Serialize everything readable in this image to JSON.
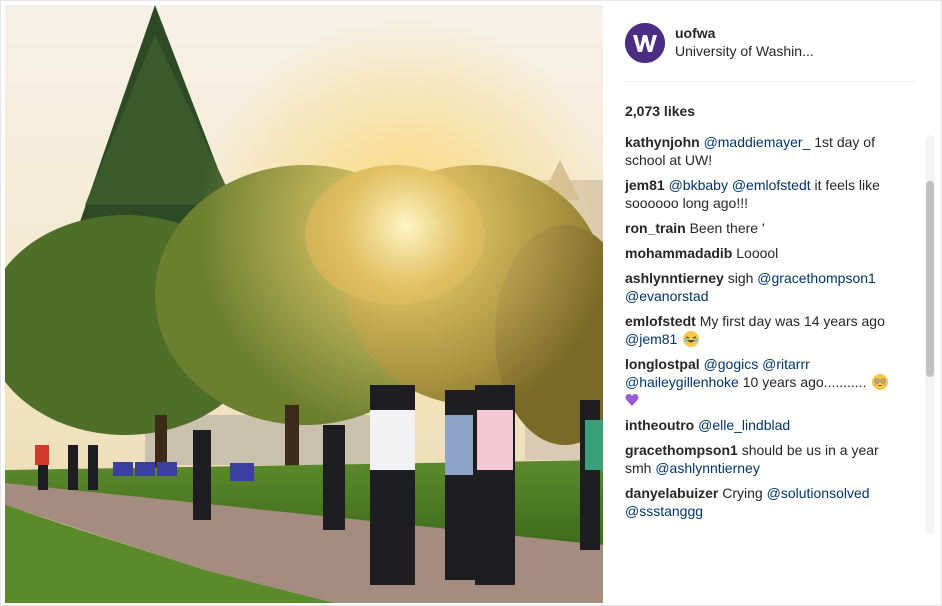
{
  "post": {
    "image_alt": "Students walking on campus under trees at sunset",
    "author": {
      "username": "uofwa",
      "full_name": "University of Washin...",
      "avatar_icon": "uw-logo-icon",
      "brand_color": "#4b2e83"
    },
    "likes": "2,073 likes",
    "comments": [
      {
        "user": "kathynjohn",
        "parts": [
          {
            "t": "@maddiemayer_",
            "m": true
          },
          {
            "t": " 1st day of school at UW!"
          }
        ]
      },
      {
        "user": "jem81",
        "parts": [
          {
            "t": "@bkbaby",
            "m": true
          },
          {
            "t": " "
          },
          {
            "t": "@emlofstedt",
            "m": true
          },
          {
            "t": " it feels like soooooo long ago!!!"
          }
        ]
      },
      {
        "user": "ron_train",
        "parts": [
          {
            "t": "Been there '"
          }
        ]
      },
      {
        "user": "mohammadadib",
        "parts": [
          {
            "t": "Looool"
          }
        ]
      },
      {
        "user": "ashlynntierney",
        "parts": [
          {
            "t": "sigh "
          },
          {
            "t": "@gracethompson1",
            "m": true
          },
          {
            "t": " "
          },
          {
            "t": "@evanorstad",
            "m": true
          }
        ]
      },
      {
        "user": "emlofstedt",
        "parts": [
          {
            "t": "My first day was 14 years ago "
          },
          {
            "t": "@jem81",
            "m": true
          },
          {
            "t": " "
          },
          {
            "e": "laughing-emoji"
          }
        ]
      },
      {
        "user": "longlostpal",
        "parts": [
          {
            "t": "@gogics",
            "m": true
          },
          {
            "t": " "
          },
          {
            "t": "@ritarrr",
            "m": true
          },
          {
            "t": " "
          },
          {
            "t": "@haileygillenhoke",
            "m": true
          },
          {
            "t": " 10 years ago........... "
          },
          {
            "e": "flushed-emoji"
          },
          {
            "t": " "
          },
          {
            "e": "purple-heart-emoji"
          }
        ]
      },
      {
        "user": "intheoutro",
        "parts": [
          {
            "t": "@elle_lindblad",
            "m": true
          }
        ]
      },
      {
        "user": "gracethompson1",
        "parts": [
          {
            "t": "should be us in a year smh "
          },
          {
            "t": "@ashlynntierney",
            "m": true
          }
        ]
      },
      {
        "user": "danyelabuizer",
        "parts": [
          {
            "t": "Crying "
          },
          {
            "t": "@solutionsolved",
            "m": true
          },
          {
            "t": " "
          },
          {
            "t": "@ssstanggg",
            "m": true
          }
        ]
      }
    ]
  },
  "colors": {
    "mention": "#003569",
    "text": "#262626"
  }
}
